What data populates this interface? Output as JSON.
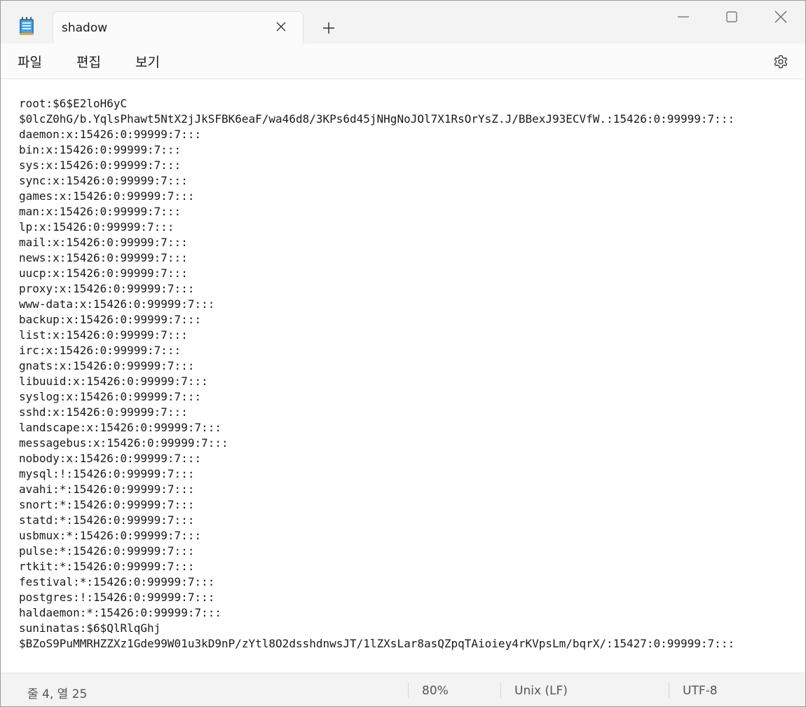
{
  "app": {
    "icon": "notepad-icon",
    "tab_title": "shadow"
  },
  "menu": {
    "file": "파일",
    "edit": "편집",
    "view": "보기"
  },
  "editor": {
    "lines": [
      "root:$6$E2loH6yC",
      "$0lcZ0hG/b.YqlsPhawt5NtX2jJkSFBK6eaF/wa46d8/3KPs6d45jNHgNoJOl7X1RsOrYsZ.J/BBexJ93ECVfW.:15426:0:99999:7:::",
      "daemon:x:15426:0:99999:7:::",
      "bin:x:15426:0:99999:7:::",
      "sys:x:15426:0:99999:7:::",
      "sync:x:15426:0:99999:7:::",
      "games:x:15426:0:99999:7:::",
      "man:x:15426:0:99999:7:::",
      "lp:x:15426:0:99999:7:::",
      "mail:x:15426:0:99999:7:::",
      "news:x:15426:0:99999:7:::",
      "uucp:x:15426:0:99999:7:::",
      "proxy:x:15426:0:99999:7:::",
      "www-data:x:15426:0:99999:7:::",
      "backup:x:15426:0:99999:7:::",
      "list:x:15426:0:99999:7:::",
      "irc:x:15426:0:99999:7:::",
      "gnats:x:15426:0:99999:7:::",
      "libuuid:x:15426:0:99999:7:::",
      "syslog:x:15426:0:99999:7:::",
      "sshd:x:15426:0:99999:7:::",
      "landscape:x:15426:0:99999:7:::",
      "messagebus:x:15426:0:99999:7:::",
      "nobody:x:15426:0:99999:7:::",
      "mysql:!:15426:0:99999:7:::",
      "avahi:*:15426:0:99999:7:::",
      "snort:*:15426:0:99999:7:::",
      "statd:*:15426:0:99999:7:::",
      "usbmux:*:15426:0:99999:7:::",
      "pulse:*:15426:0:99999:7:::",
      "rtkit:*:15426:0:99999:7:::",
      "festival:*:15426:0:99999:7:::",
      "postgres:!:15426:0:99999:7:::",
      "haldaemon:*:15426:0:99999:7:::",
      "suninatas:$6$QlRlqGhj",
      "$BZoS9PuMMRHZZXz1Gde99W01u3kD9nP/zYtl8O2dsshdnwsJT/1lZXsLar8asQZpqTAioiey4rKVpsLm/bqrX/:15427:0:99999:7:::"
    ]
  },
  "status": {
    "position": "줄 4, 열 25",
    "zoom": "80%",
    "line_ending": "Unix (LF)",
    "encoding": "UTF-8"
  }
}
